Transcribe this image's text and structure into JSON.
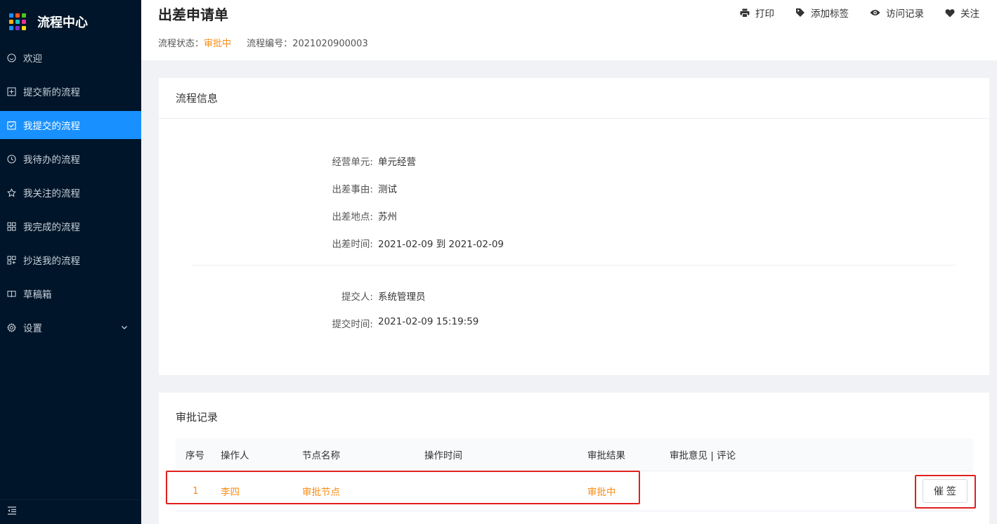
{
  "brand": {
    "title": "流程中心",
    "logo_colors": [
      "#1890ff",
      "#fa541c",
      "#52c41a",
      "#faad14",
      "#13c2c2",
      "#eb2f96",
      "#1890ff",
      "#722ed1",
      "#fadb14"
    ]
  },
  "sidebar": {
    "items": [
      {
        "label": "欢迎",
        "icon": "smile-icon"
      },
      {
        "label": "提交新的流程",
        "icon": "plus-square-icon"
      },
      {
        "label": "我提交的流程",
        "icon": "check-square-icon",
        "active": true
      },
      {
        "label": "我待办的流程",
        "icon": "clock-icon"
      },
      {
        "label": "我关注的流程",
        "icon": "star-icon"
      },
      {
        "label": "我完成的流程",
        "icon": "grid-icon"
      },
      {
        "label": "抄送我的流程",
        "icon": "copy-grid-icon"
      },
      {
        "label": "草稿箱",
        "icon": "book-icon"
      },
      {
        "label": "设置",
        "icon": "gear-icon",
        "has_submenu": true
      }
    ],
    "footer_icon": "menu-fold-icon"
  },
  "header": {
    "title": "出差申请单",
    "status_label": "流程状态：",
    "status_value": "审批中",
    "number_label": "流程编号：",
    "number_value": "2021020900003",
    "actions": [
      {
        "label": "打印",
        "icon": "printer-icon"
      },
      {
        "label": "添加标签",
        "icon": "tag-icon"
      },
      {
        "label": "访问记录",
        "icon": "eye-icon"
      },
      {
        "label": "关注",
        "icon": "heart-icon"
      }
    ]
  },
  "info": {
    "title": "流程信息",
    "fields": [
      {
        "label": "经营单元:",
        "value": "单元经营"
      },
      {
        "label": "出差事由:",
        "value": "测试"
      },
      {
        "label": "出差地点:",
        "value": "苏州"
      },
      {
        "label": "出差时间:",
        "value": "2021-02-09 到 2021-02-09"
      }
    ],
    "submit_fields": [
      {
        "label": "提交人:",
        "value": "系统管理员"
      },
      {
        "label": "提交时间:",
        "value": "2021-02-09 15:19:59"
      }
    ]
  },
  "record": {
    "title": "审批记录",
    "columns": [
      "序号",
      "操作人",
      "节点名称",
      "操作时间",
      "审批结果",
      "审批意见 | 评论"
    ],
    "rows": [
      {
        "index": "1",
        "operator": "李四",
        "node": "审批节点",
        "time": "",
        "result": "审批中",
        "comment": ""
      }
    ],
    "urge_button": "催 签"
  },
  "colors": {
    "sidebar_bg": "#001529",
    "active": "#1890ff",
    "status": "#fa8c16",
    "highlight": "#e02020"
  }
}
